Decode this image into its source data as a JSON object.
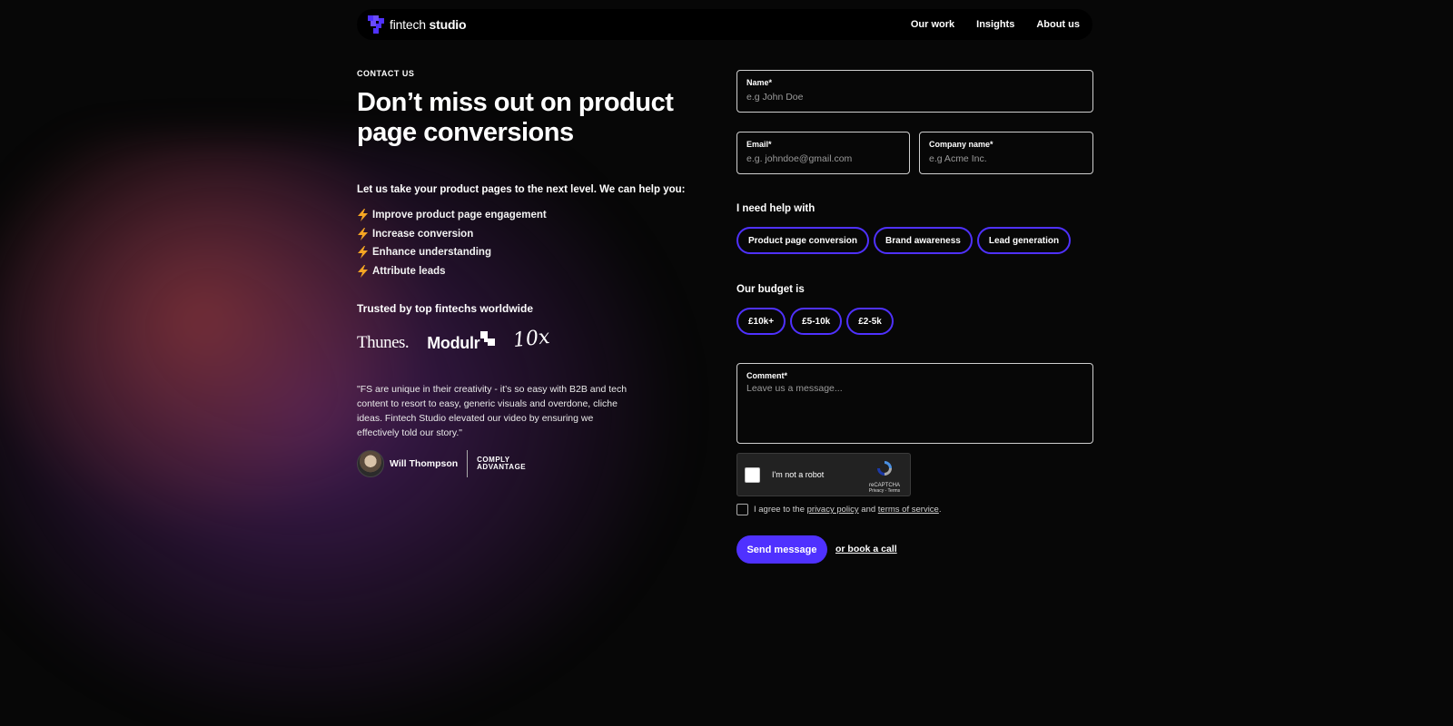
{
  "nav": {
    "logo_light": "fintech ",
    "logo_bold": "studio",
    "links": [
      "Our work",
      "Insights",
      "About us"
    ]
  },
  "hero": {
    "eyebrow": "CONTACT US",
    "headline": "Don’t miss out on product page conversions",
    "intro": "Let us take your product pages to the next level. We can help you:",
    "bullets": [
      "Improve product page engagement",
      "Increase conversion",
      "Enhance understanding",
      "Attribute leads"
    ],
    "trusted": "Trusted by top fintechs worldwide",
    "logos": [
      "Thunes.",
      "Modulr",
      "10x"
    ],
    "quote": "\"FS are unique in their creativity - it’s so easy with B2B and tech content to resort to easy, generic visuals and overdone, cliche ideas. Fintech Studio elevated our video by ensuring we effectively told our story.\"",
    "author": "Will Thompson",
    "company_line1": "COMPLY",
    "company_line2": "ADVANTAGE"
  },
  "form": {
    "name": {
      "label": "Name*",
      "placeholder": "e.g John Doe",
      "value": ""
    },
    "email": {
      "label": "Email*",
      "placeholder": "e.g. johndoe@gmail.com",
      "value": ""
    },
    "company": {
      "label": "Company name*",
      "placeholder": "e.g Acme Inc.",
      "value": ""
    },
    "help_title": "I need help with",
    "help_options": [
      "Product page conversion",
      "Brand awareness",
      "Lead generation"
    ],
    "budget_title": "Our budget is",
    "budget_options": [
      "£10k+",
      "£5-10k",
      "£2-5k"
    ],
    "comment": {
      "label": "Comment*",
      "placeholder": "Leave us a message...",
      "value": ""
    },
    "captcha": {
      "text": "I'm not a robot",
      "brand": "reCAPTCHA",
      "links": "Privacy - Terms"
    },
    "agree_prefix": "I agree to the ",
    "privacy": "privacy policy",
    "and": " and ",
    "terms": "terms of service",
    "period": ".",
    "send": "Send message",
    "book": "or book a call"
  },
  "colors": {
    "accent": "#4f31ff",
    "background": "#070707"
  }
}
